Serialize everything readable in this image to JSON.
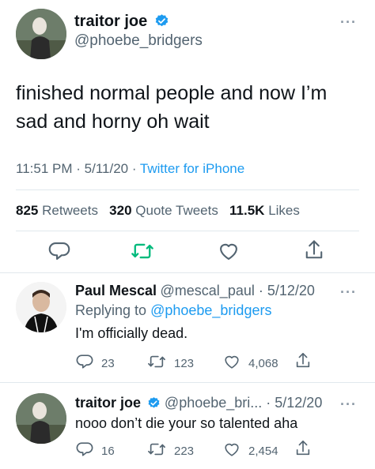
{
  "main_tweet": {
    "display_name": "traitor joe",
    "handle": "@phoebe_bridgers",
    "text_line1": "finished normal people and now I’m",
    "text_line2": "sad and horny oh wait",
    "time": "11:51 PM",
    "date": "5/11/20",
    "source": "Twitter for iPhone",
    "retweets_count": "825",
    "retweets_label": "Retweets",
    "quote_count": "320",
    "quote_label": "Quote Tweets",
    "likes_count": "11.5K",
    "likes_label": "Likes",
    "more": "···"
  },
  "replies": [
    {
      "display_name": "Paul Mescal",
      "handle_date": "@mescal_paul · 5/12/20",
      "replying_prefix": "Replying to",
      "replying_to": "@phoebe_bridgers",
      "text": "I'm officially dead.",
      "replies_count": "23",
      "retweets_count": "123",
      "likes_count": "4,068",
      "more": "···"
    },
    {
      "display_name": "traitor joe",
      "handle_date": "@phoebe_bri... · 5/12/20",
      "text": "nooo don’t die your so talented aha",
      "replies_count": "16",
      "retweets_count": "223",
      "likes_count": "2,454",
      "more": "···"
    }
  ],
  "colors": {
    "accent": "#1d9bf0",
    "retweet": "#00ba7c",
    "muted": "#536471"
  },
  "icons": [
    "verified-badge-icon",
    "reply-icon",
    "retweet-icon",
    "like-icon",
    "share-icon",
    "more-icon"
  ]
}
